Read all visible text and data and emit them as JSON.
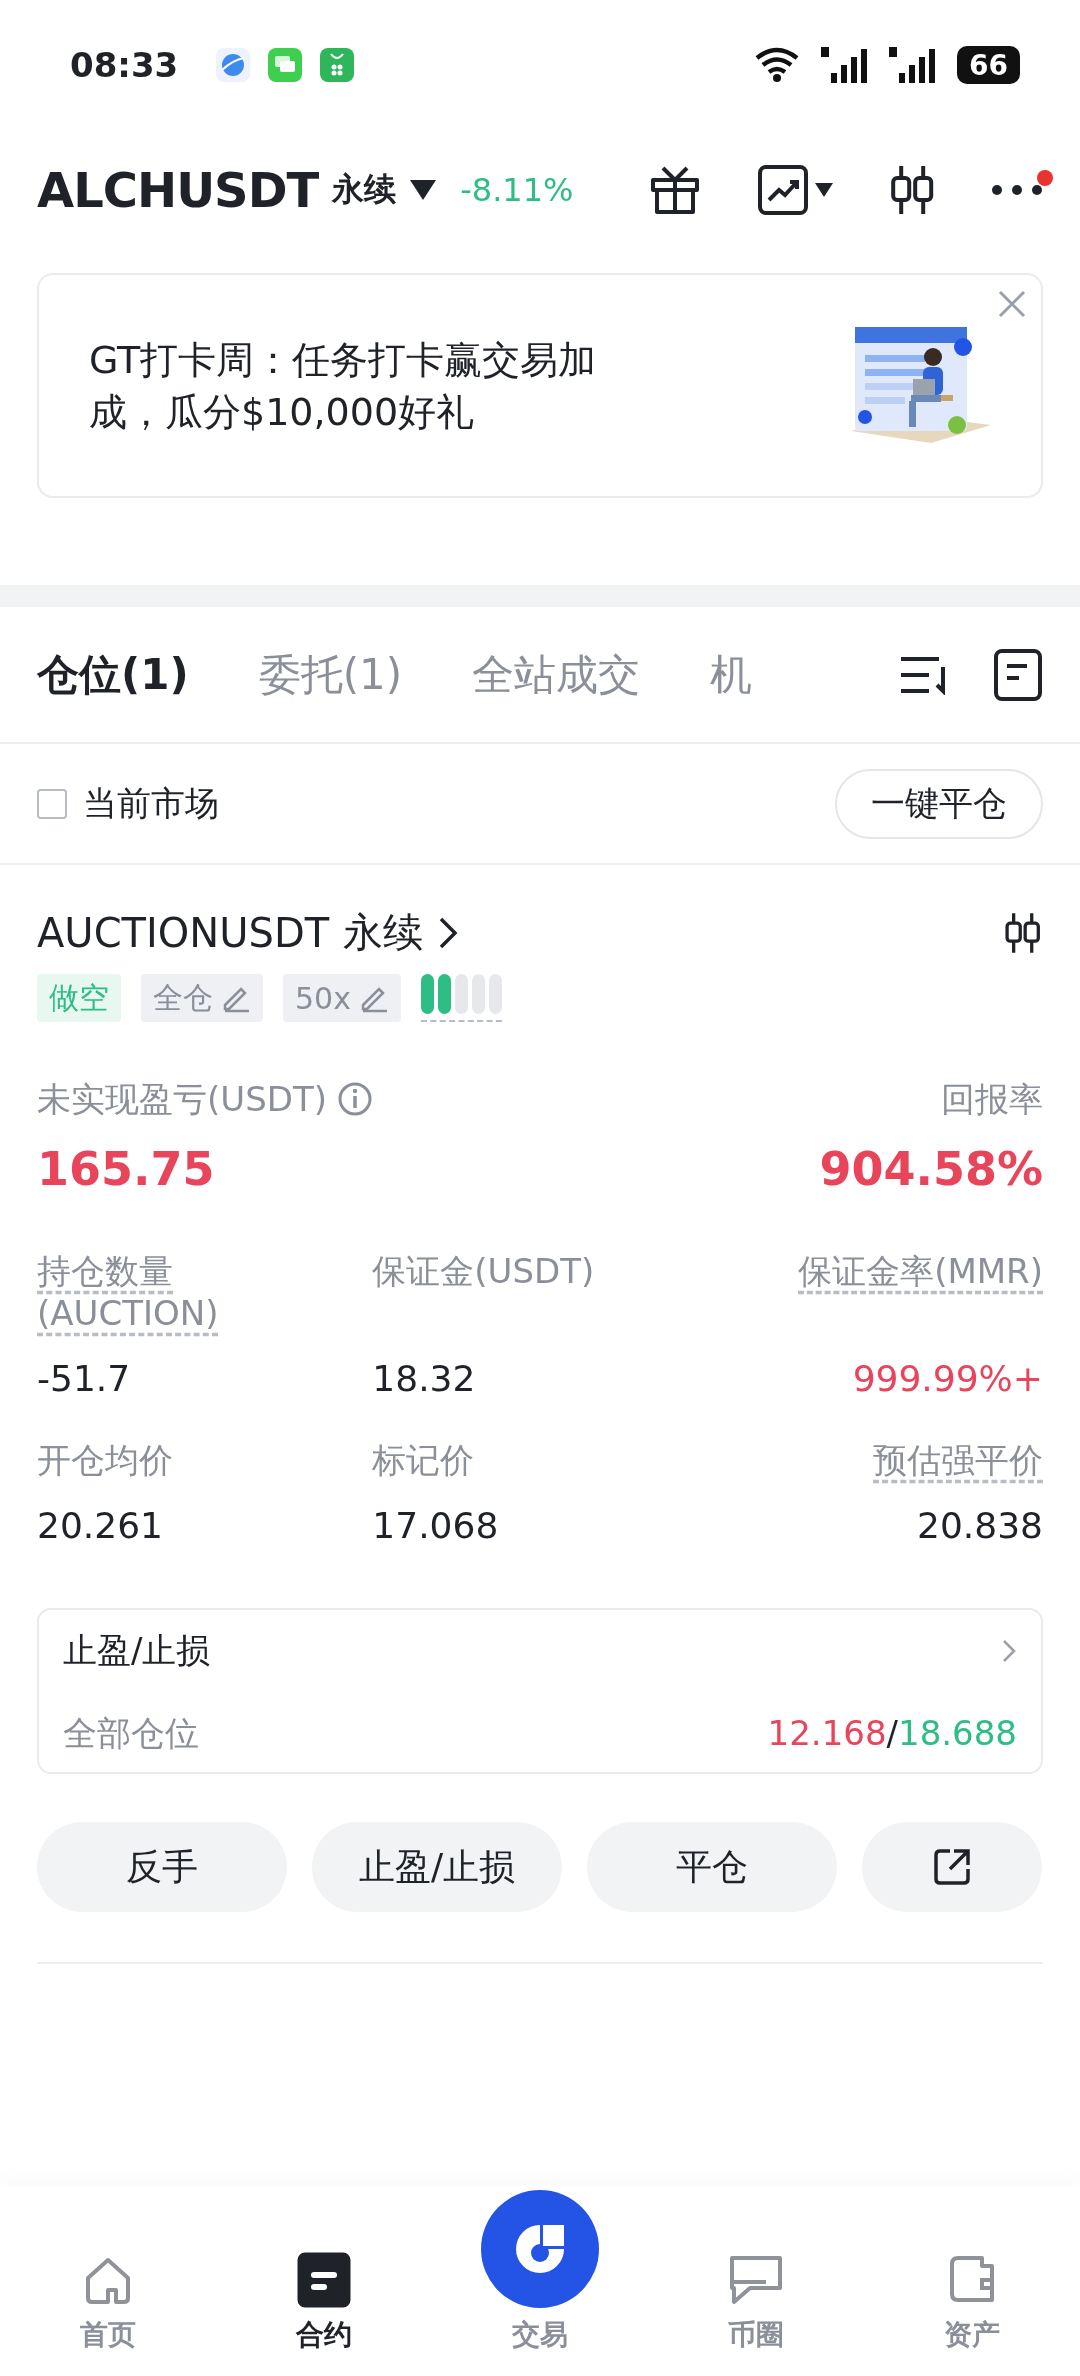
{
  "status_bar": {
    "time": "08:33",
    "battery": "66"
  },
  "header": {
    "symbol": "ALCHUSDT",
    "contract_type": "永续",
    "change": "-8.11%",
    "has_notification": true
  },
  "banner": {
    "text": "GT打卡周：任务打卡赢交易加成，瓜分$10,000好礼"
  },
  "tabs": [
    {
      "label": "仓位(1)",
      "selected": true
    },
    {
      "label": "委托(1)",
      "selected": false
    },
    {
      "label": "全站成交",
      "selected": false
    },
    {
      "label": "机",
      "selected": false
    }
  ],
  "filter": {
    "label": "当前市场",
    "checked": false,
    "close_all_button": "一键平仓"
  },
  "position": {
    "symbol": "AUCTIONUSDT",
    "contract_type": "永续",
    "side": "做空",
    "margin_mode": "全仓",
    "leverage": "50x",
    "risk": {
      "level": 0.4
    },
    "pnl_label": "未实现盈亏(USDT)",
    "pnl_value": "165.75",
    "roe_label": "回报率",
    "roe_value": "904.58%",
    "fields": [
      {
        "label": "持仓数量(AUCTION)",
        "value": "-51.7",
        "underlined": true,
        "color": "#1f2329"
      },
      {
        "label": "保证金(USDT)",
        "value": "18.32",
        "underlined": false,
        "color": "#1f2329"
      },
      {
        "label": "保证金率(MMR)",
        "value": "999.99%+",
        "underlined": true,
        "color": "#e8445a"
      },
      {
        "label": "开仓均价",
        "value": "20.261",
        "underlined": false,
        "color": "#1f2329"
      },
      {
        "label": "标记价",
        "value": "17.068",
        "underlined": false,
        "color": "#1f2329"
      },
      {
        "label": "预估强平价",
        "value": "20.838",
        "underlined": true,
        "color": "#1f2329"
      }
    ]
  },
  "tpsl": {
    "title": "止盈/止损",
    "scope": "全部仓位",
    "take_profit": "12.168",
    "separator": "/",
    "stop_loss": "18.688"
  },
  "actions": [
    "反手",
    "止盈/止损",
    "平仓"
  ],
  "bottom_nav": [
    {
      "kind": "home",
      "label": "首页",
      "selected": false
    },
    {
      "kind": "contract",
      "label": "合约",
      "selected": true
    },
    {
      "kind": "trade",
      "label": "交易",
      "selected": false
    },
    {
      "kind": "community",
      "label": "币圈",
      "selected": false
    },
    {
      "kind": "assets",
      "label": "资产",
      "selected": false
    }
  ]
}
